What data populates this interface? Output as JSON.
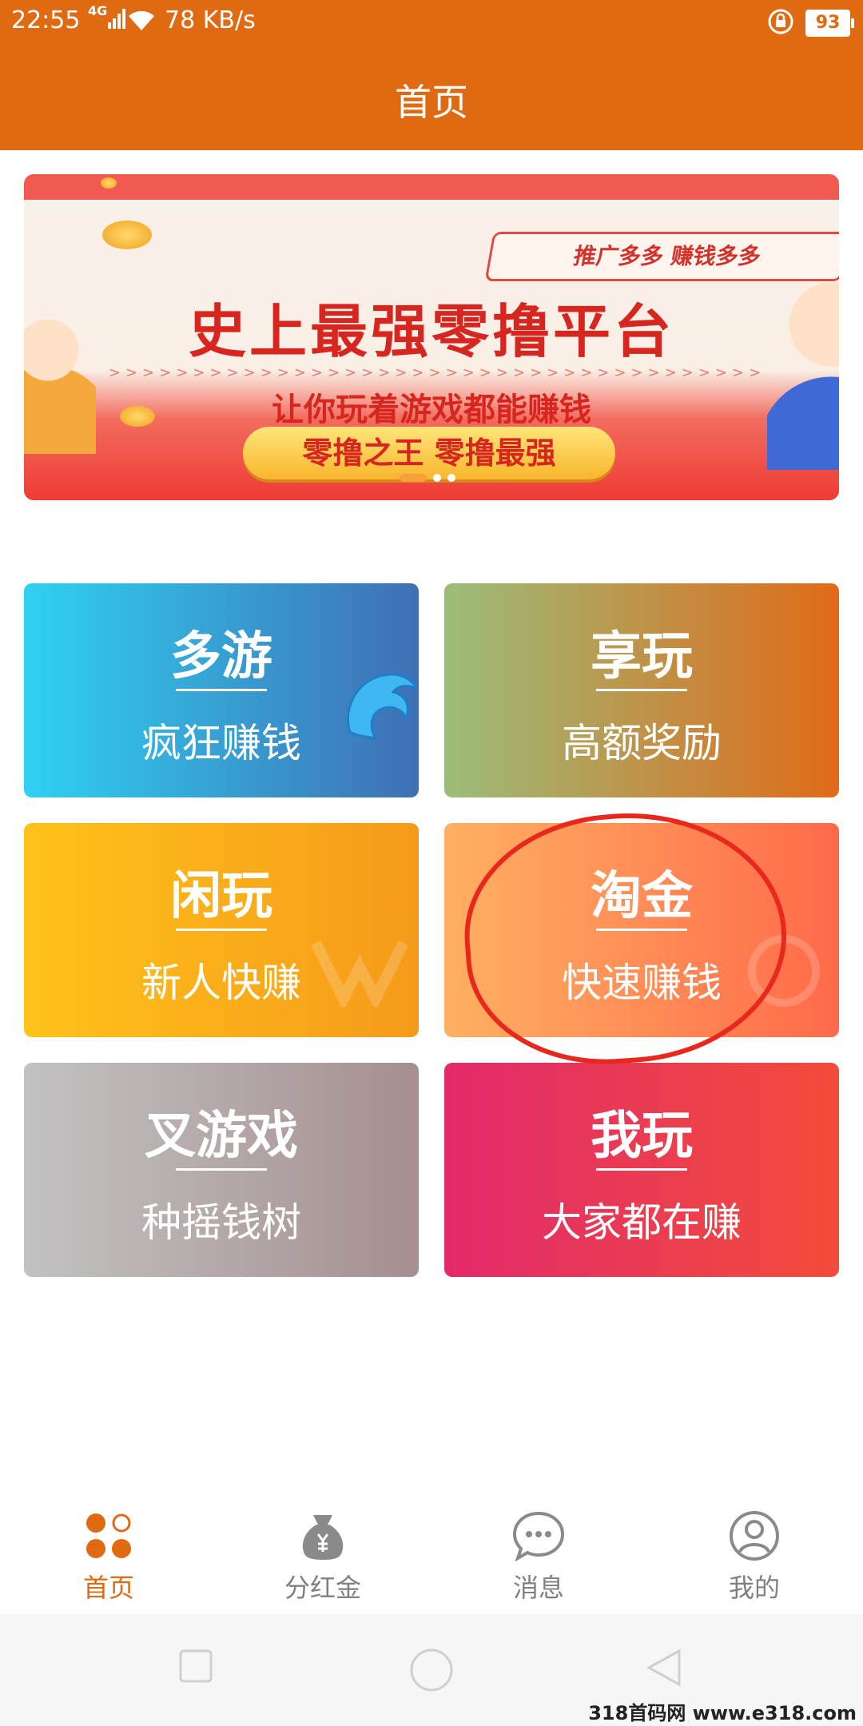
{
  "status": {
    "time": "22:55",
    "network": "4G",
    "speed": "78 KB/s",
    "battery": "93"
  },
  "header": {
    "title": "首页"
  },
  "banner": {
    "slogan": "推广多多  赚钱多多",
    "headline": "史上最强零撸平台",
    "arrows": ">>>>>>>>>>>>>>>>>>>>>>>>>>>>>>>>>>>>>>>",
    "subline": "让你玩着游戏都能赚钱",
    "pill": "零撸之王  零撸最强"
  },
  "cards": [
    {
      "name": "多游",
      "desc": "疯狂赚钱"
    },
    {
      "name": "享玩",
      "desc": "高额奖励"
    },
    {
      "name": "闲玩",
      "desc": "新人快赚"
    },
    {
      "name": "淘金",
      "desc": "快速赚钱"
    },
    {
      "name": "叉游戏",
      "desc": "种摇钱树"
    },
    {
      "name": "我玩",
      "desc": "大家都在赚"
    }
  ],
  "nav": [
    {
      "label": "首页",
      "icon": "home-dots-icon",
      "active": true
    },
    {
      "label": "分红金",
      "icon": "money-bag-icon",
      "active": false
    },
    {
      "label": "消息",
      "icon": "chat-bubble-icon",
      "active": false
    },
    {
      "label": "我的",
      "icon": "profile-icon",
      "active": false
    }
  ],
  "footer_credit": "318首码网 www.e318.com",
  "colors": {
    "accent": "#e06a12",
    "annotation": "#e8281c"
  }
}
